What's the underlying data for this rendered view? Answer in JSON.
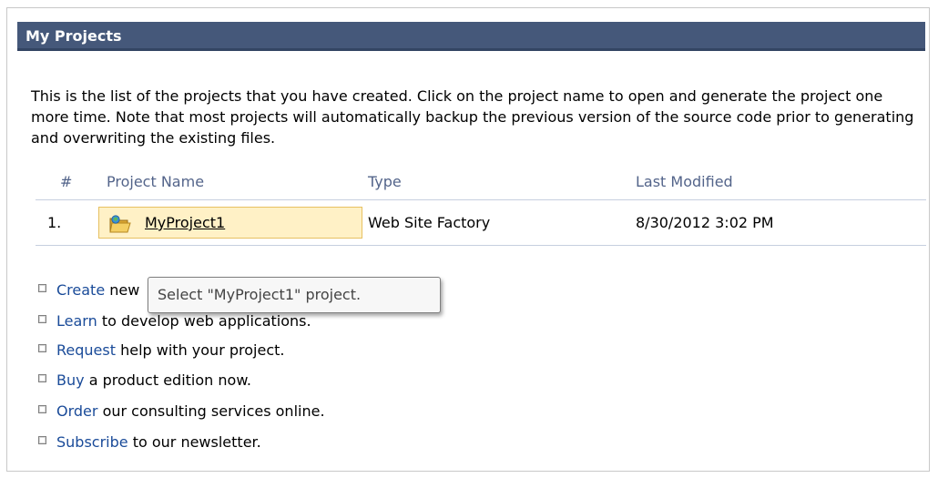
{
  "panel": {
    "title": "My Projects"
  },
  "intro": "This is the list of the projects that you have created. Click on the project name to open and generate the project one more time. Note that most projects will automatically backup the previous version of the source code prior to generating and overwriting the existing files.",
  "table": {
    "headers": {
      "num": "#",
      "name": "Project Name",
      "type": "Type",
      "modified": "Last Modified"
    },
    "rows": [
      {
        "num": "1.",
        "name": "MyProject1",
        "type": "Web Site Factory",
        "modified": "8/30/2012 3:02 PM",
        "icon": "folder-open-icon"
      }
    ]
  },
  "links": [
    {
      "link": "Create",
      "rest": "new"
    },
    {
      "link": "Learn",
      "rest": "to develop web applications."
    },
    {
      "link": "Request",
      "rest": "help with your project."
    },
    {
      "link": "Buy",
      "rest": "a product edition now."
    },
    {
      "link": "Order",
      "rest": "our consulting services online."
    },
    {
      "link": "Subscribe",
      "rest": "to our newsletter."
    }
  ],
  "tooltip": "Select \"MyProject1\" project.",
  "colors": {
    "title_bar": "#45587a",
    "link": "#1a4b99",
    "row_highlight": "#fff1c6",
    "header_text": "#53648a"
  }
}
